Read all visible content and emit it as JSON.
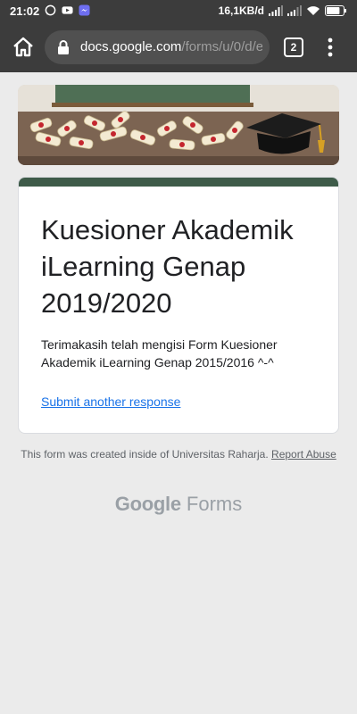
{
  "status_bar": {
    "time": "21:02",
    "net_speed": "16,1KB/d",
    "battery_level": 0.8
  },
  "browser": {
    "url_host": "docs.google.com",
    "url_path": "/forms/u/0/d/e",
    "tab_count": "2"
  },
  "form": {
    "title": "Kuesioner Akademik iLearning Genap 2019/2020",
    "description": "Terimakasih telah mengisi Form Kuesioner Akademik iLearning Genap 2015/2016 ^-^",
    "submit_another_label": "Submit another response",
    "accent_color": "#3e5b49"
  },
  "footer": {
    "created_text": "This form was created inside of Universitas Raharja.",
    "report_abuse_label": "Report Abuse",
    "brand_google": "Google",
    "brand_forms": "Forms"
  }
}
